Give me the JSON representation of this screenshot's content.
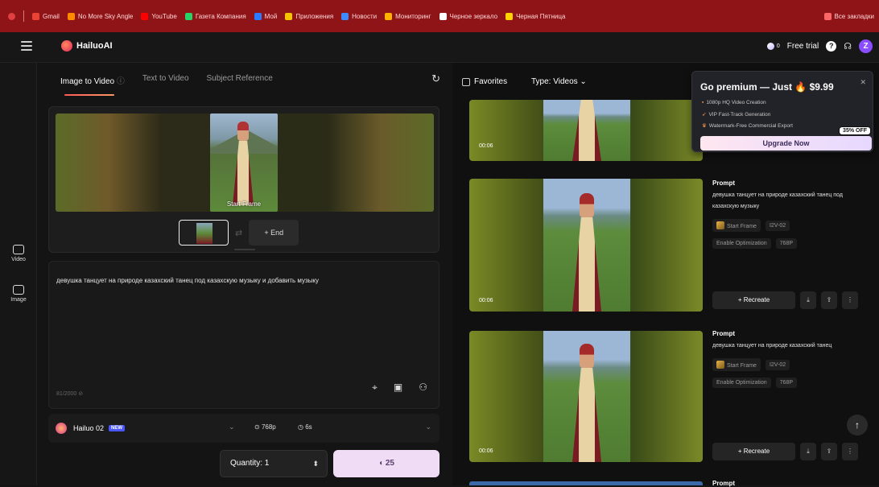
{
  "bookmarks": [
    {
      "label": "Gmail",
      "color": "#ea4335"
    },
    {
      "label": "No More Sky Angle",
      "color": "#ff8a00"
    },
    {
      "label": "YouTube",
      "color": "#ff0000"
    },
    {
      "label": "Газета Компания",
      "color": "#25d366"
    },
    {
      "label": "Мой",
      "color": "#2a7bff"
    },
    {
      "label": "Приложения",
      "color": "#f5c400"
    },
    {
      "label": "Новости",
      "color": "#3b8bff"
    },
    {
      "label": "Мониторинг",
      "color": "#ffb300"
    },
    {
      "label": "Черное зеркало",
      "color": "#ffffff"
    },
    {
      "label": "Черная Пятница",
      "color": "#ffd400"
    },
    {
      "label": "Все закладки",
      "color": "#ff6666"
    }
  ],
  "header": {
    "logo_text": "HailuoAI",
    "credits": "0",
    "free_trial": "Free trial",
    "help": "?",
    "notifications_icon": "headset-icon",
    "avatar_letter": "Z"
  },
  "rail": [
    {
      "label": "Video",
      "icon": "video-icon"
    },
    {
      "label": "Image",
      "icon": "image-icon"
    }
  ],
  "tabs": [
    "Image to Video",
    "Text to Video",
    "Subject Reference"
  ],
  "upload": {
    "start_frame_label": "Start Frame",
    "end_button": "+ End"
  },
  "prompt": {
    "text": "девушка танцует на природе казахский танец под казахскую музыку и добавить музыку",
    "char_count": "81/2000"
  },
  "model": {
    "name": "Hailuo 02",
    "badge": "NEW",
    "resolution": "768p",
    "duration": "6s"
  },
  "quantity": {
    "label": "Quantity: 1"
  },
  "generate": {
    "cost": "25"
  },
  "feed": {
    "favorites_label": "Favorites",
    "type_label": "Type: Videos",
    "cards": [
      {
        "duration": "00:06",
        "has_meta": false
      },
      {
        "duration": "00:06",
        "has_meta": true,
        "prompt_title": "Prompt",
        "prompt_text": "девушка танцует на природе казахский танец под казахскую музыку",
        "chip_start": "Start Frame",
        "chip_model": "I2V-02",
        "chip_opt": "Enable Optimization",
        "chip_res": "768P",
        "recreate": "+ Recreate"
      },
      {
        "duration": "00:06",
        "has_meta": true,
        "prompt_title": "Prompt",
        "prompt_text": "девушка танцует на природе казахский танец",
        "chip_start": "Start Frame",
        "chip_model": "I2V-02",
        "chip_opt": "Enable Optimization",
        "chip_res": "768P",
        "recreate": "+ Recreate"
      }
    ],
    "next_prompt_title": "Prompt"
  },
  "promo": {
    "title": "Go premium — Just 🔥 $9.99",
    "features": [
      "1080p HQ Video Creation",
      "VIP Fast-Track Generation",
      "Watermark-Free Commercial Export"
    ],
    "button": "Upgrade Now",
    "badge": "35% OFF"
  },
  "colors": {
    "accent_gradient_start": "#ff5a5a",
    "generate_bg": "#f0dcf5",
    "bookmark_bar": "#8f1418"
  }
}
